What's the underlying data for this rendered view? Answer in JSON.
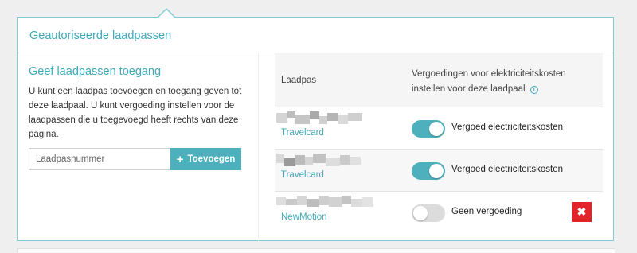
{
  "panel": {
    "title": "Geautoriseerde laadpassen"
  },
  "left": {
    "title": "Geef laadpassen toegang",
    "description": "U kunt een laadpas toevoegen en toegang geven tot deze laadpaal. U kunt vergoeding instellen voor de laadpassen die u toegevoegd heeft rechts van deze pagina.",
    "input_placeholder": "Laadpasnummer",
    "add_button_label": "Toevoegen",
    "add_button_icon": "plus-icon"
  },
  "table": {
    "col_laadpas": "Laadpas",
    "col_vergoeding": "Vergoedingen voor elektriciteitskosten instellen voor deze laadpaal",
    "info_icon": "i",
    "rows": [
      {
        "brand": "Travelcard",
        "toggle_on": true,
        "toggle_label": "Vergoed electriciteitskosten",
        "deletable": false
      },
      {
        "brand": "Travelcard",
        "toggle_on": true,
        "toggle_label": "Vergoed electriciteitskosten",
        "deletable": false
      },
      {
        "brand": "NewMotion",
        "toggle_on": false,
        "toggle_label": "Geen vergoeding",
        "deletable": true,
        "delete_icon": "✖"
      }
    ]
  },
  "colors": {
    "accent": "#3fa9b8",
    "toggle_on": "#4eb0bc",
    "delete": "#e3242b"
  }
}
